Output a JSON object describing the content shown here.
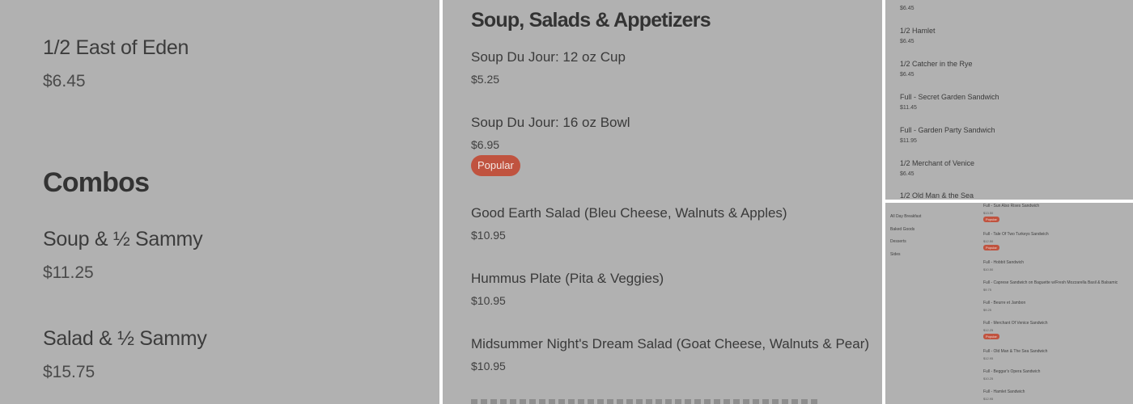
{
  "panel1": {
    "item_top": {
      "name": "1/2 East of Eden",
      "price": "$6.45"
    },
    "heading": "Combos",
    "items": [
      {
        "name": "Soup & ½ Sammy",
        "price": "$11.25"
      },
      {
        "name": "Salad & ½ Sammy",
        "price": "$15.75"
      }
    ]
  },
  "panel2": {
    "heading": "Soup, Salads & Appetizers",
    "badge_label": "Popular",
    "items": [
      {
        "name": "Soup Du Jour: 12 oz Cup",
        "price": "$5.25"
      },
      {
        "name": "Soup Du Jour: 16 oz Bowl",
        "price": "$6.95"
      },
      {
        "name": "Good Earth Salad (Bleu Cheese, Walnuts & Apples)",
        "price": "$10.95"
      },
      {
        "name": "Hummus Plate (Pita & Veggies)",
        "price": "$10.95"
      },
      {
        "name": "Midsummer Night's Dream Salad (Goat Cheese, Walnuts & Pear)",
        "price": "$10.95"
      }
    ]
  },
  "panel3": {
    "top_price": "$6.45",
    "items": [
      {
        "name": "1/2 Hamlet",
        "price": "$6.45"
      },
      {
        "name": "1/2 Catcher in the Rye",
        "price": "$6.45"
      },
      {
        "name": "Full - Secret Garden Sandwich",
        "price": "$11.45"
      },
      {
        "name": "Full - Garden Party Sandwich",
        "price": "$11.95"
      },
      {
        "name": "1/2 Merchant of Venice",
        "price": "$6.45"
      },
      {
        "name": "1/2 Old Man & the Sea",
        "price": ""
      }
    ]
  },
  "panel4": {
    "badge_label": "Popular",
    "categories": [
      "All Day Breakfast",
      "Baked Goods",
      "Desserts",
      "Sides"
    ],
    "items": [
      {
        "name": "Full - Sun Also Rises Sandwich",
        "price": "$13.50"
      },
      {
        "name": "Full - Tale Of Two Turkeys Sandwich",
        "price": "$12.50"
      },
      {
        "name": "Full - Hobbit Sandwich",
        "price": "$10.50"
      },
      {
        "name": "Full - Caprese Sandwich on Baguette w/Fresh Mozzarella Basil & Balsamic",
        "price": "$9.75"
      },
      {
        "name": "Full - Beurre et Jambon",
        "price": "$9.25"
      },
      {
        "name": "Full - Merchant Of Venice Sandwich",
        "price": "$12.25"
      },
      {
        "name": "Full - Old Man & The Sea Sandwich",
        "price": "$12.95"
      },
      {
        "name": "Full - Beggar's Opera Sandwich",
        "price": "$10.25"
      },
      {
        "name": "Full - Hamlet Sandwich",
        "price": "$12.95"
      }
    ]
  }
}
